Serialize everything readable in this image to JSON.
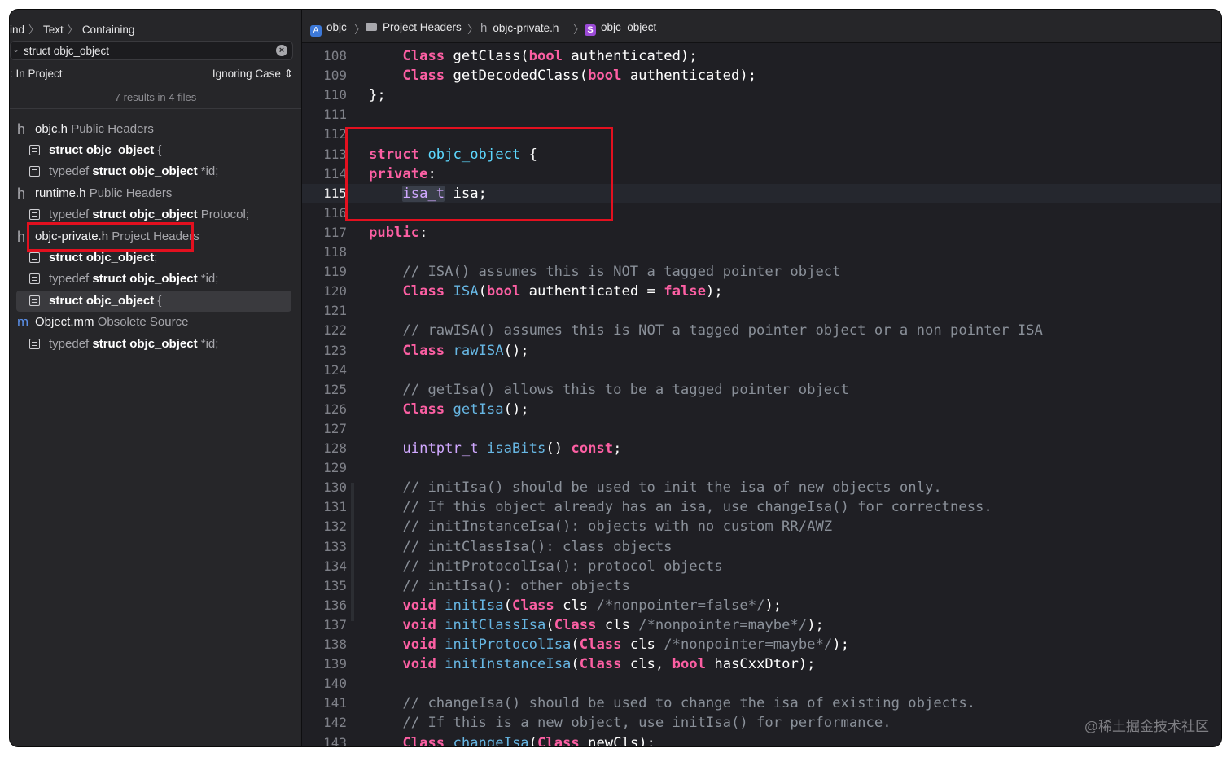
{
  "sidebar": {
    "breadcrumb": [
      "ind",
      "Text",
      "Containing"
    ],
    "search": {
      "value": "struct objc_object"
    },
    "scope": "In Project",
    "case_option": "Ignoring Case",
    "summary": "7 results in 4 files",
    "results": [
      {
        "kind": "file",
        "name": "objc.h",
        "group": "Public Headers",
        "icon": "h-icon"
      },
      {
        "kind": "match",
        "pre": "",
        "bold": "struct objc_object",
        "post": " {"
      },
      {
        "kind": "match",
        "pre": "typedef ",
        "bold": "struct objc_object",
        "post": " *id;"
      },
      {
        "kind": "file",
        "name": "runtime.h",
        "group": "Public Headers",
        "icon": "h-icon"
      },
      {
        "kind": "match",
        "pre": "typedef ",
        "bold": "struct objc_object",
        "post": " Protocol;"
      },
      {
        "kind": "file",
        "name": "objc-private.h",
        "group": "Project Headers",
        "icon": "h-icon"
      },
      {
        "kind": "match",
        "pre": "",
        "bold": "struct objc_object",
        "post": ";"
      },
      {
        "kind": "match",
        "pre": "typedef ",
        "bold": "struct objc_object",
        "post": " *id;"
      },
      {
        "kind": "match",
        "pre": "",
        "bold": "struct objc_object",
        "post": " {",
        "selected": true
      },
      {
        "kind": "file",
        "name": "Object.mm",
        "group": "Obsolete Source",
        "icon": "mm-icon"
      },
      {
        "kind": "match",
        "pre": "typedef ",
        "bold": "struct objc_object",
        "post": " *id;"
      }
    ]
  },
  "jumpbar": [
    "objc",
    "Project Headers",
    "objc-private.h",
    "objc_object"
  ],
  "colors": {
    "keyword": "#fc5fa3",
    "type": "#d0a8ff",
    "function": "#67b7e4",
    "comment": "#8a9099",
    "highlight_box": "#e3101f"
  },
  "code": {
    "current_line": 115,
    "lines": [
      {
        "n": "108",
        "t": [
          [
            "",
            "    "
          ],
          [
            "kw",
            "Class"
          ],
          [
            "",
            " getClass("
          ],
          [
            "kw",
            "bool"
          ],
          [
            "",
            " authenticated);"
          ]
        ]
      },
      {
        "n": "109",
        "t": [
          [
            "",
            "    "
          ],
          [
            "kw",
            "Class"
          ],
          [
            "",
            " getDecodedClass("
          ],
          [
            "kw",
            "bool"
          ],
          [
            "",
            " authenticated);"
          ]
        ]
      },
      {
        "n": "110",
        "t": [
          [
            "",
            "};"
          ]
        ]
      },
      {
        "n": "111",
        "t": []
      },
      {
        "n": "112",
        "t": []
      },
      {
        "n": "113",
        "t": [
          [
            "kw",
            "struct"
          ],
          [
            "",
            " "
          ],
          [
            "tl",
            "objc_object"
          ],
          [
            "",
            " {"
          ]
        ]
      },
      {
        "n": "114",
        "t": [
          [
            "kw",
            "private"
          ],
          [
            "",
            ":"
          ]
        ]
      },
      {
        "n": "115",
        "t": [
          [
            "",
            "    "
          ],
          [
            "hl",
            "isa_t"
          ],
          [
            "",
            " isa;"
          ]
        ]
      },
      {
        "n": "116",
        "t": []
      },
      {
        "n": "117",
        "t": [
          [
            "kw",
            "public"
          ],
          [
            "",
            ":"
          ]
        ]
      },
      {
        "n": "118",
        "t": []
      },
      {
        "n": "119",
        "t": [
          [
            "",
            "    "
          ],
          [
            "cm",
            "// ISA() assumes this is NOT a tagged pointer object"
          ]
        ]
      },
      {
        "n": "120",
        "t": [
          [
            "",
            "    "
          ],
          [
            "kw",
            "Class"
          ],
          [
            "",
            " "
          ],
          [
            "fn",
            "ISA"
          ],
          [
            "",
            "("
          ],
          [
            "kw",
            "bool"
          ],
          [
            "",
            " authenticated = "
          ],
          [
            "kw",
            "false"
          ],
          [
            "",
            ");"
          ]
        ]
      },
      {
        "n": "121",
        "t": []
      },
      {
        "n": "122",
        "t": [
          [
            "",
            "    "
          ],
          [
            "cm",
            "// rawISA() assumes this is NOT a tagged pointer object or a non pointer ISA"
          ]
        ]
      },
      {
        "n": "123",
        "t": [
          [
            "",
            "    "
          ],
          [
            "kw",
            "Class"
          ],
          [
            "",
            " "
          ],
          [
            "fn",
            "rawISA"
          ],
          [
            "",
            "();"
          ]
        ]
      },
      {
        "n": "124",
        "t": []
      },
      {
        "n": "125",
        "t": [
          [
            "",
            "    "
          ],
          [
            "cm",
            "// getIsa() allows this to be a tagged pointer object"
          ]
        ]
      },
      {
        "n": "126",
        "t": [
          [
            "",
            "    "
          ],
          [
            "kw",
            "Class"
          ],
          [
            "",
            " "
          ],
          [
            "fn",
            "getIsa"
          ],
          [
            "",
            "();"
          ]
        ]
      },
      {
        "n": "127",
        "t": []
      },
      {
        "n": "128",
        "t": [
          [
            "",
            "    "
          ],
          [
            "ty",
            "uintptr_t"
          ],
          [
            "",
            " "
          ],
          [
            "fn",
            "isaBits"
          ],
          [
            "",
            "() "
          ],
          [
            "kw",
            "const"
          ],
          [
            "",
            ";"
          ]
        ]
      },
      {
        "n": "129",
        "t": []
      },
      {
        "n": "130",
        "t": [
          [
            "",
            "    "
          ],
          [
            "cm",
            "// initIsa() should be used to init the isa of new objects only."
          ]
        ]
      },
      {
        "n": "131",
        "t": [
          [
            "",
            "    "
          ],
          [
            "cm",
            "// If this object already has an isa, use changeIsa() for correctness."
          ]
        ]
      },
      {
        "n": "132",
        "t": [
          [
            "",
            "    "
          ],
          [
            "cm",
            "// initInstanceIsa(): objects with no custom RR/AWZ"
          ]
        ]
      },
      {
        "n": "133",
        "t": [
          [
            "",
            "    "
          ],
          [
            "cm",
            "// initClassIsa(): class objects"
          ]
        ]
      },
      {
        "n": "134",
        "t": [
          [
            "",
            "    "
          ],
          [
            "cm",
            "// initProtocolIsa(): protocol objects"
          ]
        ]
      },
      {
        "n": "135",
        "t": [
          [
            "",
            "    "
          ],
          [
            "cm",
            "// initIsa(): other objects"
          ]
        ]
      },
      {
        "n": "136",
        "t": [
          [
            "",
            "    "
          ],
          [
            "kw",
            "void"
          ],
          [
            "",
            " "
          ],
          [
            "fn",
            "initIsa"
          ],
          [
            "",
            "("
          ],
          [
            "kw",
            "Class"
          ],
          [
            "",
            " cls "
          ],
          [
            "cm",
            "/*nonpointer=false*/"
          ],
          [
            "",
            ");"
          ]
        ]
      },
      {
        "n": "137",
        "t": [
          [
            "",
            "    "
          ],
          [
            "kw",
            "void"
          ],
          [
            "",
            " "
          ],
          [
            "fn",
            "initClassIsa"
          ],
          [
            "",
            "("
          ],
          [
            "kw",
            "Class"
          ],
          [
            "",
            " cls "
          ],
          [
            "cm",
            "/*nonpointer=maybe*/"
          ],
          [
            "",
            ");"
          ]
        ]
      },
      {
        "n": "138",
        "t": [
          [
            "",
            "    "
          ],
          [
            "kw",
            "void"
          ],
          [
            "",
            " "
          ],
          [
            "fn",
            "initProtocolIsa"
          ],
          [
            "",
            "("
          ],
          [
            "kw",
            "Class"
          ],
          [
            "",
            " cls "
          ],
          [
            "cm",
            "/*nonpointer=maybe*/"
          ],
          [
            "",
            ");"
          ]
        ]
      },
      {
        "n": "139",
        "t": [
          [
            "",
            "    "
          ],
          [
            "kw",
            "void"
          ],
          [
            "",
            " "
          ],
          [
            "fn",
            "initInstanceIsa"
          ],
          [
            "",
            "("
          ],
          [
            "kw",
            "Class"
          ],
          [
            "",
            " cls, "
          ],
          [
            "kw",
            "bool"
          ],
          [
            "",
            " hasCxxDtor);"
          ]
        ]
      },
      {
        "n": "140",
        "t": []
      },
      {
        "n": "141",
        "t": [
          [
            "",
            "    "
          ],
          [
            "cm",
            "// changeIsa() should be used to change the isa of existing objects."
          ]
        ]
      },
      {
        "n": "142",
        "t": [
          [
            "",
            "    "
          ],
          [
            "cm",
            "// If this is a new object, use initIsa() for performance."
          ]
        ]
      },
      {
        "n": "143",
        "t": [
          [
            "",
            "    "
          ],
          [
            "kw",
            "Class"
          ],
          [
            "",
            " "
          ],
          [
            "fn",
            "changeIsa"
          ],
          [
            "",
            "("
          ],
          [
            "kw",
            "Class"
          ],
          [
            "",
            " newCls);"
          ]
        ]
      }
    ]
  },
  "watermark": "@稀土掘金技术社区"
}
